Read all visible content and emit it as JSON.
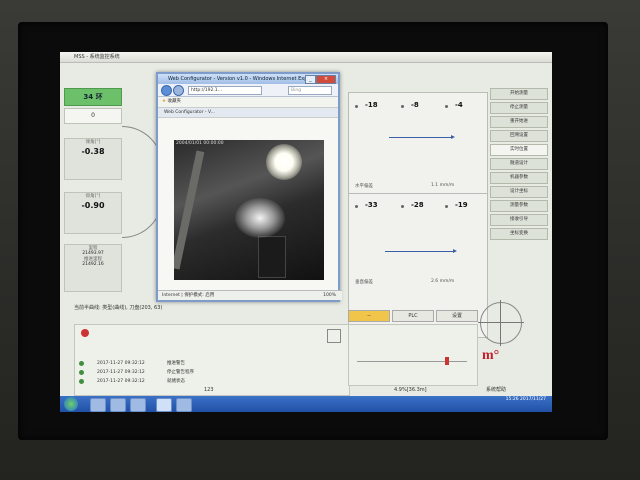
{
  "window": {
    "title": "MSS - 系统监控系统"
  },
  "left": {
    "ring_label": "34 环",
    "count_label": "0",
    "pitch_label": "倾角[°]",
    "pitch_value": "-0.38",
    "roll_label": "仰角[°]",
    "roll_value": "-0.90",
    "odo_label": "里程",
    "odo_value1": "21493.97",
    "odo_label2": "推进里程",
    "odo_value2": "21492.16"
  },
  "browser": {
    "title": "Web Configurator - Version v1.0 - Windows Internet Explorer",
    "address": "http://192.1...",
    "search_placeholder": "Bing",
    "fav_label": "收藏夹",
    "tab_label": "Web Configurator - V...",
    "camera_overlay": "2004/01/01 00:00:00",
    "status_left": "Internet | 保护模式: 启用",
    "status_zoom": "100%"
  },
  "right_panel": {
    "row1": [
      "-18",
      "-8",
      "-4"
    ],
    "caption1": "水平偏差",
    "unit1": "1.1 mm/m",
    "row2": [
      "-33",
      "-28",
      "-19"
    ],
    "caption2": "垂直偏差",
    "unit2": "2.6 mm/m"
  },
  "right_buttons": [
    "开始测量",
    "停止测量",
    "重开始进",
    "回溯设置",
    "实时位置",
    "隧道设计",
    "机器参数",
    "设计坐标",
    "测量参数",
    "接收引导",
    "坐标变换"
  ],
  "bottom": {
    "control_text": "当前半曲线: 类型(曲线), 刀盘(203, 63)",
    "tabs": [
      "--",
      "PLC",
      "设置"
    ],
    "messages": [
      {
        "time": "2017-11-27 09:32:12",
        "text": "推进警告"
      },
      {
        "time": "2017-11-27 09:32:12",
        "text": "停止警告程序"
      },
      {
        "time": "2017-11-27 09:32:12",
        "text": "就绪状态"
      }
    ],
    "footer_center": "123",
    "footer_pos": "4.9%[36.3m]",
    "footer_right": "系统帮助",
    "clock": "15:26\n2017/11/27"
  },
  "colors": {
    "accent": "#6dc06a",
    "tab_selected": "#f1c44a",
    "logo": "#c2202a"
  }
}
